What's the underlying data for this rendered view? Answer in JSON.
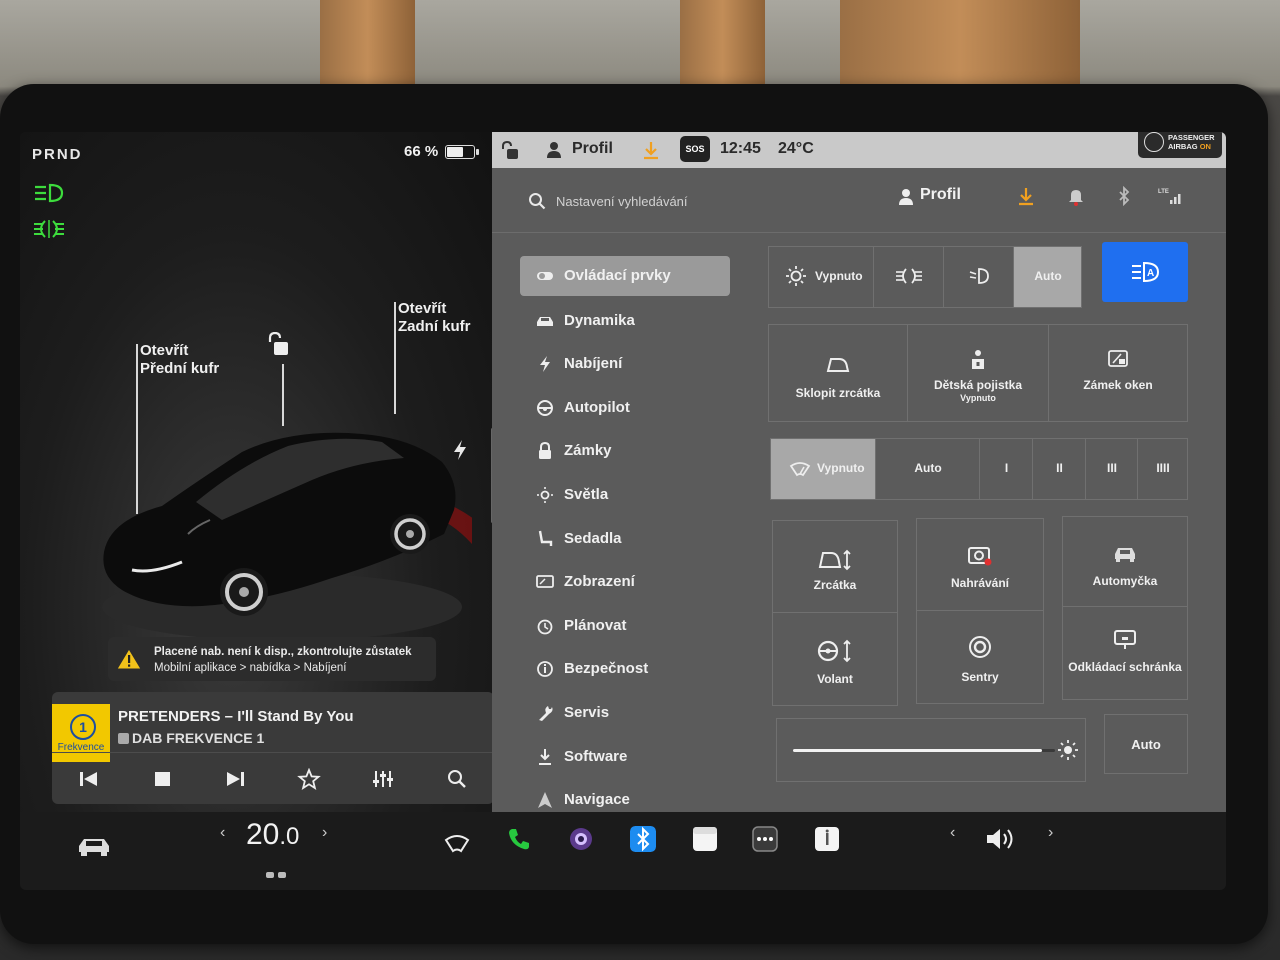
{
  "vehicle_panel": {
    "gear": "PRND",
    "battery_percent": "66 %",
    "battery_level": 0.66,
    "front_trunk_label_1": "Otevřít",
    "front_trunk_label_2": "Přední kufr",
    "rear_trunk_label_1": "Otevřít",
    "rear_trunk_label_2": "Zadní kufr",
    "warning_line1": "Placené nab. není k disp., zkontrolujte zůstatek",
    "warning_line2": "Mobilní aplikace > nabídka > Nabíjení"
  },
  "media": {
    "logo_number": "1",
    "logo_label": "Frekvence",
    "song": "PRETENDERS – I'll Stand By You",
    "station": "DAB FREKVENCE 1"
  },
  "status_bar": {
    "profile": "Profil",
    "sos": "SOS",
    "time": "12:45",
    "temperature": "24°C",
    "airbag_line1": "PASSENGER",
    "airbag_line2": "AIRBAG",
    "airbag_state": "ON"
  },
  "settings": {
    "search_placeholder": "Nastavení vyhledávání",
    "profile": "Profil",
    "nav": [
      {
        "label": "Ovládací prvky",
        "icon": "toggle-icon"
      },
      {
        "label": "Dynamika",
        "icon": "car-icon"
      },
      {
        "label": "Nabíjení",
        "icon": "bolt-icon"
      },
      {
        "label": "Autopilot",
        "icon": "steering-wheel-icon"
      },
      {
        "label": "Zámky",
        "icon": "lock-icon"
      },
      {
        "label": "Světla",
        "icon": "light-icon"
      },
      {
        "label": "Sedadla",
        "icon": "seat-icon"
      },
      {
        "label": "Zobrazení",
        "icon": "display-icon"
      },
      {
        "label": "Plánovat",
        "icon": "clock-icon"
      },
      {
        "label": "Bezpečnost",
        "icon": "info-icon"
      },
      {
        "label": "Servis",
        "icon": "wrench-icon"
      },
      {
        "label": "Software",
        "icon": "download-icon"
      },
      {
        "label": "Navigace",
        "icon": "navigation-icon"
      }
    ],
    "lights": {
      "off": "Vypnuto",
      "auto": "Auto",
      "selected": "Auto"
    },
    "tiles_row1": [
      {
        "label": "Sklopit zrcátka"
      },
      {
        "label": "Dětská pojistka",
        "sub": "Vypnuto"
      },
      {
        "label": "Zámek oken"
      }
    ],
    "wipers": {
      "off": "Vypnuto",
      "auto": "Auto",
      "speeds": [
        "I",
        "II",
        "III",
        "IIII"
      ],
      "selected": "Vypnuto"
    },
    "tiles_grid": [
      {
        "label": "Zrcátka"
      },
      {
        "label": "Nahrávání"
      },
      {
        "label": "Automyčka"
      },
      {
        "label": "Volant"
      },
      {
        "label": "Sentry"
      },
      {
        "label": "Odkládací schránka"
      }
    ],
    "brightness_auto": "Auto",
    "brightness_level": 0.95
  },
  "dock": {
    "temperature": "20.0",
    "temp_whole": "20",
    "temp_decimal": ".0"
  },
  "colors": {
    "accent_blue": "#1f6ff0",
    "indicator_green": "#3ddc3d",
    "download_orange": "#f0a020"
  }
}
